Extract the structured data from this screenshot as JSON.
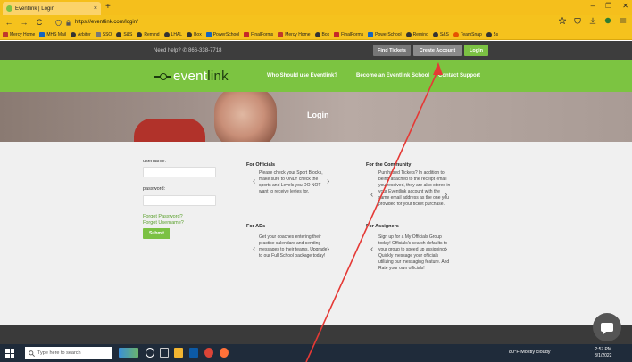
{
  "browser": {
    "tab_title": "Eventlink | Login",
    "tab_close": "×",
    "new_tab": "+",
    "url": "https://eventlink.com/login/",
    "back": "←",
    "forward": "→",
    "reload": "C",
    "window_min": "–",
    "window_max": "❐",
    "window_close": "✕",
    "bookmarks": [
      "Mercy Home",
      "MHS Mail",
      "Arbiter",
      "SSO",
      "S&S",
      "Remind",
      "LHAL",
      "Box",
      "PowerSchool",
      "FinalForms",
      "Mercy Home",
      "Box",
      "FinalForms",
      "PowerSchool",
      "Remind",
      "S&S",
      "TeamSnap",
      "5s"
    ]
  },
  "site_top": {
    "help": "Need help?  ✆ 866-338-7718",
    "find_tickets": "Find Tickets",
    "create_account": "Create Account",
    "login": "Login"
  },
  "header": {
    "logo_text": "event",
    "logo_suffix": "link",
    "nav": [
      "Who Should use Eventlink?",
      "Become an Eventlink School",
      "Contact Support"
    ]
  },
  "hero": {
    "title": "Login"
  },
  "form": {
    "username_label": "username:",
    "password_label": "password:",
    "forgot_password": "Forgot Password?",
    "forgot_username": "Forgot Username?",
    "submit": "Submit"
  },
  "cards": [
    {
      "title": "For Officials",
      "text": "Please check your Sport Blocks, make sure to ONLY check the sports and Levels you DO NOT want to receive levies for."
    },
    {
      "title": "For the Community",
      "text": "Purchased Tickets? In addition to being attached to the receipt email you received, they are also stored in your Eventlink account with the same email address as the one you provided for your ticket purchase."
    },
    {
      "title": "For ADs",
      "text": "Get your coaches entering their practice calendars and sending messages to their teams. Upgrade to our Full School package today!"
    },
    {
      "title": "For Assigners",
      "text": "Sign up for a My Officials Group today! Officials's search defaults to your group to speed up assigning. Quickly message your officials utilizing our messaging feature. And Rate your own officials!"
    }
  ],
  "taskbar": {
    "search_placeholder": "Type here to search",
    "weather": "80°F Mostly cloudy",
    "time": "2:57 PM",
    "date": "8/1/2022"
  },
  "colors": {
    "brand_green": "#7cc441",
    "browser_chrome": "#f5c21d",
    "annotation": "#e53935"
  }
}
